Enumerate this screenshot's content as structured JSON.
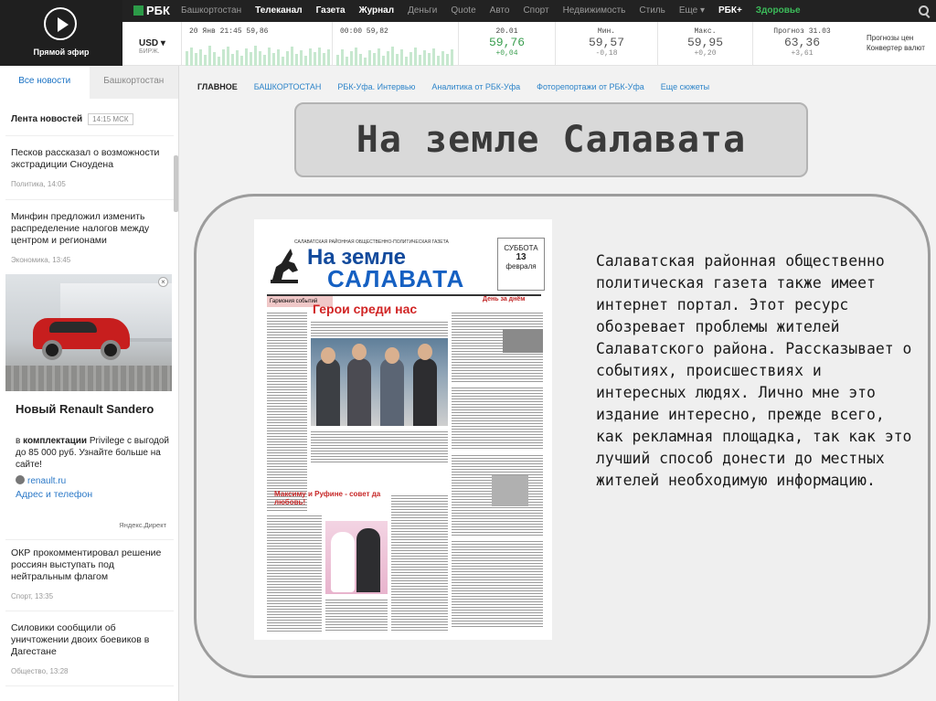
{
  "live": {
    "label": "Прямой эфир"
  },
  "nav": {
    "logo": "РБК",
    "items": [
      {
        "label": "Башкортостан",
        "style": "grey"
      },
      {
        "label": "Телеканал",
        "style": "white"
      },
      {
        "label": "Газета",
        "style": "white"
      },
      {
        "label": "Журнал",
        "style": "white"
      },
      {
        "label": "Деньги",
        "style": "grey"
      },
      {
        "label": "Quote",
        "style": "grey"
      },
      {
        "label": "Авто",
        "style": "grey"
      },
      {
        "label": "Спорт",
        "style": "grey"
      },
      {
        "label": "Недвижимость",
        "style": "grey"
      },
      {
        "label": "Стиль",
        "style": "grey"
      },
      {
        "label": "Еще ▾",
        "style": "grey"
      },
      {
        "label": "РБК+",
        "style": "white"
      },
      {
        "label": "Здоровье",
        "style": "green"
      }
    ],
    "search_icon": "search-icon"
  },
  "quotes": {
    "currency": "USD ▾",
    "exchange": "БИРЖ.",
    "spark1_header": "20 Янв 21:45 59,86",
    "spark2_header": "00:00 59,82",
    "cells": [
      {
        "title": "20.01",
        "value": "59,76",
        "delta": "+0,04",
        "green": true
      },
      {
        "title": "Мин.",
        "value": "59,57",
        "delta": "-0,18",
        "green": false
      },
      {
        "title": "Макс.",
        "value": "59,95",
        "delta": "+0,20",
        "green": false
      },
      {
        "title": "Прогноз 31.03",
        "value": "63,36",
        "delta": "+3,61",
        "green": false
      }
    ],
    "link1": "Прогнозы цен",
    "link2": "Конвертер валют"
  },
  "sidebar": {
    "tab_all": "Все новости",
    "tab_region": "Башкортостан",
    "feed_title": "Лента новостей",
    "feed_time": "14:15 МСК",
    "news": [
      {
        "title": "Песков рассказал о возможности экстрадиции Сноудена",
        "meta": "Политика, 14:05"
      },
      {
        "title": "Минфин предложил изменить распределение налогов между центром и регионами",
        "meta": "Экономика, 13:45"
      },
      {
        "title": "ОКР прокомментировал решение россиян выступать под нейтральным флагом",
        "meta": "Спорт, 13:35"
      },
      {
        "title": "Силовики сообщили об уничтожении двоих боевиков в Дагестане",
        "meta": "Общество, 13:28"
      }
    ],
    "ad": {
      "title": "Новый Renault Sandero",
      "text_prefix": "в ",
      "text_bold": "комплектации",
      "text_rest": " Privilege с выгодой до 85 000 руб. Узнайте больше на сайте!",
      "domain": "renault.ru",
      "address": "Адрес и телефон",
      "source": "Яндекс.Директ",
      "close": "×"
    }
  },
  "main": {
    "subnav": [
      {
        "label": "ГЛАВНОЕ",
        "active": true
      },
      {
        "label": "БАШКОРТОСТАН",
        "active": false
      },
      {
        "label": "РБК-Уфа. Интервью",
        "active": false
      },
      {
        "label": "Аналитика от РБК-Уфа",
        "active": false
      },
      {
        "label": "Фоторепортажи от РБК-Уфа",
        "active": false
      },
      {
        "label": "Еще сюжеты",
        "active": false
      }
    ],
    "slide_title": "На земле Салавата",
    "body": "Салаватская районная общественно политическая газета также имеет интернет портал. Этот ресурс обозревает проблемы жителей Салаватского района. Рассказывает о событиях, происшествиях и интересных людях. Лично мне это издание интересно, прежде всего, как рекламная площадка, так как это лучший способ донести до местных жителей необходимую информацию."
  },
  "newspaper": {
    "subheader": "САЛАВАТСКАЯ РАЙОННАЯ ОБЩЕСТВЕННО-ПОЛИТИЧЕСКАЯ ГАЗЕТА",
    "name1": "На земле",
    "name2": "САЛАВАТА",
    "date_day": "СУББОТА",
    "date_num": "13",
    "date_month": "февраля",
    "rubric": "Гармония событий",
    "headline": "Герои среди нас",
    "right_header": "День за днём",
    "story2": "Максиму и Руфине - совет да любовь!"
  }
}
